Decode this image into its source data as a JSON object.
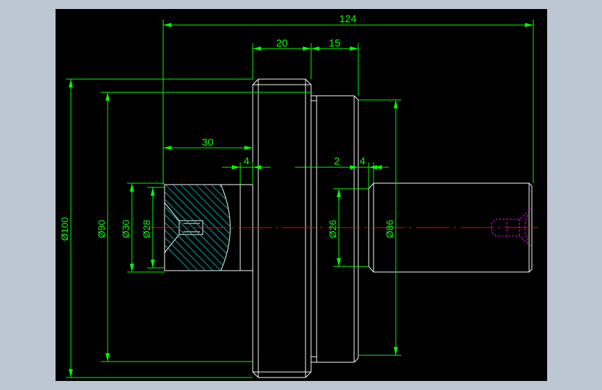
{
  "window": {
    "background_color": "#bdc6d3",
    "canvas_color": "#000000"
  },
  "colors": {
    "dimension": "#00ff00",
    "outline": "#ffffff",
    "centerline": "#ff0000",
    "hatch": "#00c8c8",
    "hidden_thread": "#ff00ff"
  },
  "dimensions": {
    "overall_length": "124",
    "gear_width": "20",
    "hub_width": "15",
    "left_shaft_length": "30",
    "left_chamfer": "4",
    "undercut": "2",
    "right_chamfer": "4",
    "dia_100": "Ø100",
    "dia_90": "Ø90",
    "dia_30": "Ø30",
    "dia_28": "Ø28",
    "dia_26": "Ø26",
    "dia_86": "Ø86"
  }
}
